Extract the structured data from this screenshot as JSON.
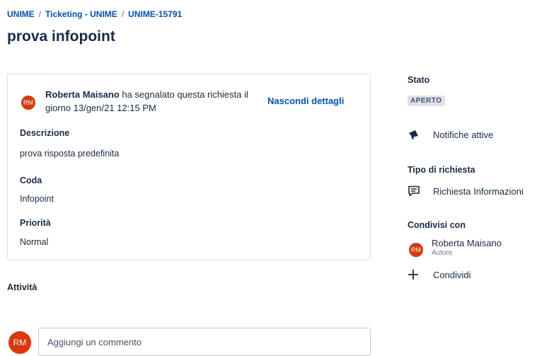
{
  "breadcrumb": {
    "items": [
      "UNIME",
      "Ticketing - UNIME",
      "UNIME-15791"
    ],
    "separator": "/"
  },
  "page_title": "prova infopoint",
  "request_card": {
    "reporter_initials": "RM",
    "reporter_name": "Roberta Maisano",
    "reported_text": " ha segnalato questa richiesta il giorno 13/gen/21 12:15 PM",
    "hide_details_label": "Nascondi dettagli",
    "fields": [
      {
        "label": "Descrizione",
        "value": "prova risposta predefinita"
      },
      {
        "label": "Coda",
        "value": "Infopoint"
      },
      {
        "label": "Priorità",
        "value": "Normal"
      }
    ]
  },
  "activity": {
    "title": "Attività",
    "user_initials": "RM",
    "comment_placeholder": "Aggiungi un commento"
  },
  "sidebar": {
    "status_label": "Stato",
    "status_value": "APERTO",
    "notifications_label": "Notifiche attive",
    "request_type_label": "Tipo di richiesta",
    "request_type_value": "Richiesta Informazioni",
    "shared_with_label": "Condivisi con",
    "shared_user": {
      "initials": "RM",
      "name": "Roberta Maisano",
      "role": "Autore"
    },
    "share_label": "Condividi"
  },
  "colors": {
    "link": "#0052cc",
    "avatar": "#de350b",
    "text": "#172b4d"
  },
  "icons": [
    "megaphone-icon",
    "chat-icon",
    "plus-icon"
  ]
}
